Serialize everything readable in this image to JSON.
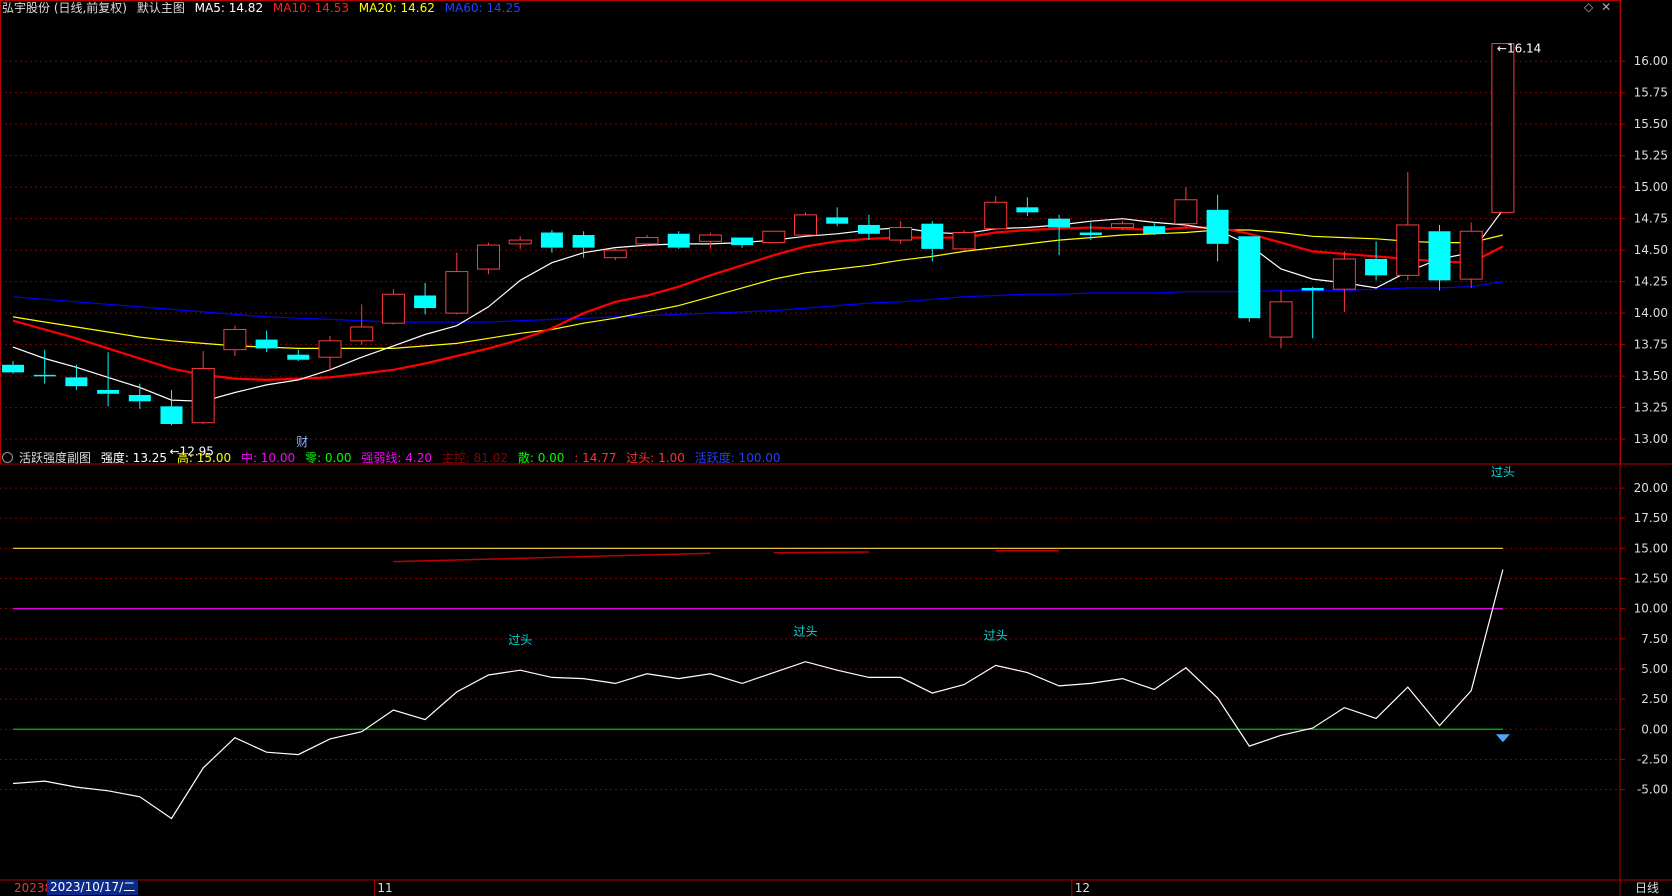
{
  "main_header": {
    "stock": "弘宇股份 (日线,前复权)",
    "template": "默认主图",
    "ma5": "MA5: 14.82",
    "ma10": "MA10: 14.53",
    "ma20": "MA20: 14.62",
    "ma60": "MA60: 14.25"
  },
  "sub_header": {
    "name": "活跃强度副图",
    "strength": "强度: 13.25",
    "high": "高: 15.00",
    "mid": "中: 10.00",
    "zero": "零: 0.00",
    "weak": "强弱线: 4.20",
    "main": "主控: 81.02",
    "retail": "散: 0.00",
    "blank": ": 14.77",
    "over": "过头: 1.00",
    "active": "活跃度: 100.00"
  },
  "bottom": {
    "year_fragment": "20238",
    "date": "2023/10/17/二",
    "period": "日线"
  },
  "colors": {
    "up": "#ff3b3b",
    "down": "#00ffff",
    "ma5": "#ffffff",
    "ma10": "#ff0000",
    "ma20": "#ffff00",
    "ma60": "#0000ff",
    "grid": "#8b0000",
    "frame": "#b00000"
  },
  "chart_data": {
    "type": "candlestick",
    "main_ylim": [
      12.85,
      16.2
    ],
    "main_yticks": [
      "16.00",
      "15.75",
      "15.50",
      "15.25",
      "15.00",
      "14.75",
      "14.50",
      "14.25",
      "14.00",
      "13.75",
      "13.50",
      "13.25",
      "13.00"
    ],
    "sub_ylim": [
      -12.5,
      21.5
    ],
    "sub_yticks": [
      "20.00",
      "17.50",
      "15.00",
      "12.50",
      "10.00",
      "7.50",
      "5.00",
      "2.50",
      "0.00",
      "-2.50",
      "-5.00"
    ],
    "x_month_labels": [
      {
        "label": "11",
        "index": 12
      },
      {
        "label": "12",
        "index": 34
      }
    ],
    "candles": [
      [
        13.59,
        13.53,
        13.52,
        13.62
      ],
      [
        13.51,
        13.5,
        13.44,
        13.71
      ],
      [
        13.49,
        13.42,
        13.39,
        13.59
      ],
      [
        13.39,
        13.36,
        13.26,
        13.69
      ],
      [
        13.35,
        13.3,
        13.24,
        13.44
      ],
      [
        13.26,
        13.12,
        13.11,
        13.39
      ],
      [
        13.13,
        13.56,
        13.12,
        13.7
      ],
      [
        13.71,
        13.87,
        13.66,
        13.9
      ],
      [
        13.79,
        13.72,
        13.69,
        13.86
      ],
      [
        13.67,
        13.63,
        13.62,
        13.71
      ],
      [
        13.65,
        13.78,
        13.54,
        13.82
      ],
      [
        13.78,
        13.89,
        13.75,
        14.07
      ],
      [
        13.92,
        14.15,
        13.91,
        14.19
      ],
      [
        14.14,
        14.04,
        13.99,
        14.24
      ],
      [
        14.0,
        14.33,
        13.99,
        14.48
      ],
      [
        14.35,
        14.54,
        14.31,
        14.56
      ],
      [
        14.55,
        14.58,
        14.51,
        14.61
      ],
      [
        14.64,
        14.52,
        14.48,
        14.66
      ],
      [
        14.62,
        14.52,
        14.44,
        14.65
      ],
      [
        14.44,
        14.5,
        14.42,
        14.51
      ],
      [
        14.55,
        14.6,
        14.53,
        14.62
      ],
      [
        14.63,
        14.52,
        14.51,
        14.65
      ],
      [
        14.57,
        14.62,
        14.51,
        14.64
      ],
      [
        14.6,
        14.54,
        14.52,
        14.6
      ],
      [
        14.56,
        14.65,
        14.56,
        14.65
      ],
      [
        14.62,
        14.78,
        14.62,
        14.8
      ],
      [
        14.76,
        14.71,
        14.69,
        14.84
      ],
      [
        14.7,
        14.63,
        14.58,
        14.78
      ],
      [
        14.58,
        14.68,
        14.55,
        14.73
      ],
      [
        14.71,
        14.51,
        14.41,
        14.73
      ],
      [
        14.51,
        14.64,
        14.49,
        14.66
      ],
      [
        14.67,
        14.88,
        14.66,
        14.93
      ],
      [
        14.84,
        14.8,
        14.77,
        14.92
      ],
      [
        14.75,
        14.68,
        14.46,
        14.78
      ],
      [
        14.64,
        14.62,
        14.58,
        14.72
      ],
      [
        14.68,
        14.71,
        14.66,
        14.73
      ],
      [
        14.69,
        14.63,
        14.62,
        14.72
      ],
      [
        14.71,
        14.9,
        14.67,
        15.0
      ],
      [
        14.82,
        14.55,
        14.41,
        14.94
      ],
      [
        14.61,
        13.96,
        13.93,
        14.61
      ],
      [
        13.81,
        14.09,
        13.72,
        14.18
      ],
      [
        14.2,
        14.18,
        13.8,
        14.21
      ],
      [
        14.19,
        14.43,
        14.01,
        14.49
      ],
      [
        14.43,
        14.3,
        14.26,
        14.57
      ],
      [
        14.3,
        14.7,
        14.26,
        15.12
      ],
      [
        14.65,
        14.26,
        14.18,
        14.7
      ],
      [
        14.27,
        14.65,
        14.2,
        14.72
      ],
      [
        14.8,
        16.14,
        14.8,
        16.14
      ]
    ],
    "ma5": [
      13.73,
      13.64,
      13.57,
      13.49,
      13.41,
      13.31,
      13.3,
      13.37,
      13.43,
      13.47,
      13.55,
      13.65,
      13.74,
      13.83,
      13.9,
      14.05,
      14.26,
      14.4,
      14.48,
      14.52,
      14.54,
      14.55,
      14.55,
      14.56,
      14.58,
      14.61,
      14.63,
      14.66,
      14.68,
      14.64,
      14.63,
      14.67,
      14.68,
      14.7,
      14.73,
      14.75,
      14.72,
      14.7,
      14.66,
      14.54,
      14.35,
      14.27,
      14.24,
      14.2,
      14.33,
      14.43,
      14.48,
      14.82
    ],
    "ma10": [
      13.94,
      13.87,
      13.8,
      13.72,
      13.64,
      13.56,
      13.51,
      13.48,
      13.47,
      13.48,
      13.49,
      13.52,
      13.55,
      13.6,
      13.66,
      13.72,
      13.79,
      13.88,
      14.0,
      14.09,
      14.14,
      14.21,
      14.3,
      14.38,
      14.46,
      14.53,
      14.57,
      14.59,
      14.6,
      14.6,
      14.6,
      14.64,
      14.66,
      14.67,
      14.68,
      14.67,
      14.66,
      14.68,
      14.68,
      14.63,
      14.56,
      14.49,
      14.47,
      14.45,
      14.43,
      14.41,
      14.4,
      14.53
    ],
    "ma20": [
      13.97,
      13.93,
      13.89,
      13.85,
      13.81,
      13.78,
      13.76,
      13.74,
      13.73,
      13.72,
      13.72,
      13.72,
      13.72,
      13.74,
      13.76,
      13.8,
      13.84,
      13.87,
      13.92,
      13.96,
      14.01,
      14.06,
      14.13,
      14.2,
      14.27,
      14.32,
      14.35,
      14.38,
      14.42,
      14.45,
      14.49,
      14.52,
      14.55,
      14.58,
      14.6,
      14.62,
      14.63,
      14.64,
      14.66,
      14.66,
      14.64,
      14.61,
      14.6,
      14.59,
      14.57,
      14.56,
      14.56,
      14.62
    ],
    "ma60": [
      14.13,
      14.11,
      14.09,
      14.07,
      14.05,
      14.03,
      14.01,
      13.99,
      13.97,
      13.96,
      13.95,
      13.94,
      13.93,
      13.93,
      13.93,
      13.93,
      13.94,
      13.95,
      13.96,
      13.97,
      13.98,
      13.99,
      14.0,
      14.01,
      14.02,
      14.04,
      14.06,
      14.08,
      14.09,
      14.11,
      14.13,
      14.14,
      14.15,
      14.15,
      14.16,
      14.16,
      14.16,
      14.17,
      14.17,
      14.17,
      14.18,
      14.18,
      14.18,
      14.19,
      14.2,
      14.2,
      14.21,
      14.25
    ],
    "strength": [
      -4.5,
      -4.3,
      -4.8,
      -5.1,
      -5.6,
      -7.4,
      -3.2,
      -0.7,
      -1.9,
      -2.1,
      -0.8,
      -0.2,
      1.6,
      0.8,
      3.1,
      4.5,
      4.9,
      4.3,
      4.2,
      3.8,
      4.6,
      4.2,
      4.6,
      3.8,
      4.7,
      5.6,
      4.9,
      4.3,
      4.3,
      3.0,
      3.7,
      5.3,
      4.7,
      3.6,
      3.8,
      4.2,
      3.3,
      5.1,
      2.6,
      -1.4,
      -0.5,
      0.1,
      1.8,
      0.9,
      3.5,
      0.3,
      3.2,
      13.25
    ],
    "high_line": 15.0,
    "mid_line": 10.0,
    "zero_line": 0.0,
    "over_label": "过头",
    "over_marks": [
      16,
      25,
      31,
      47
    ],
    "red_segments": [
      [
        12,
        22,
        13.9,
        14.6
      ],
      [
        24,
        27,
        14.65,
        14.7
      ],
      [
        31,
        33,
        14.8,
        14.8
      ]
    ],
    "max_label": "16.14",
    "min_label": "12.95",
    "min_index": 5,
    "fin_label": "财",
    "fin_index": 9
  }
}
